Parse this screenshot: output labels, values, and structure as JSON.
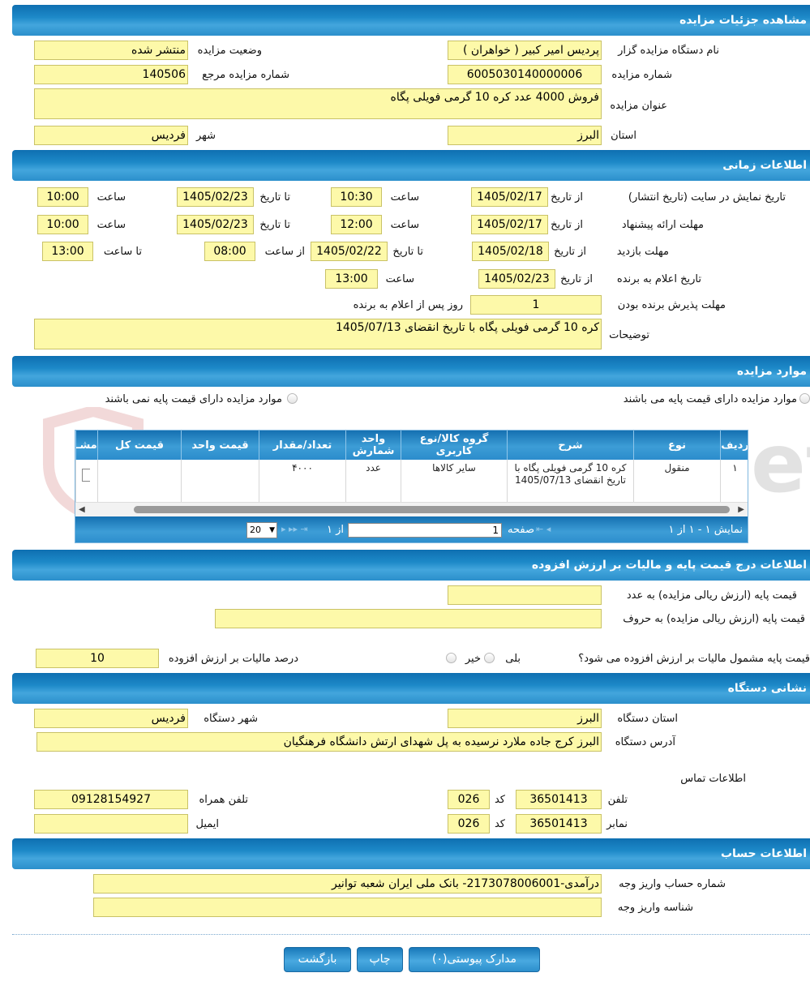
{
  "sections": {
    "details": "مشاهده جزئیات مزایده",
    "time": "اطلاعات زمانی",
    "items": "موارد مزایده",
    "price": "اطلاعات درج قیمت پایه و مالیات بر ارزش افزوده",
    "address": "نشانی دستگاه",
    "account": "اطلاعات حساب"
  },
  "details": {
    "org_label": "نام دستگاه مزایده گزار",
    "org_value": "پردیس امیر کبیر ( خواهران )",
    "status_label": "وضعیت مزایده",
    "status_value": "منتشر شده",
    "number_label": "شماره مزایده",
    "number_value": "6005030140000006",
    "ref_label": "شماره مزایده مرجع",
    "ref_value": "140506",
    "title_label": "عنوان مزایده",
    "title_value": "فروش 4000 عدد کره 10 گرمی فویلی پگاه",
    "province_label": "استان",
    "province_value": "البرز",
    "city_label": "شهر",
    "city_value": "فردیس"
  },
  "time": {
    "display_label": "تاریخ نمایش در سایت (تاریخ انتشار)",
    "display_from": "1405/02/17",
    "display_from_time": "10:30",
    "display_to": "1405/02/23",
    "display_to_time": "10:00",
    "offer_label": "مهلت ارائه پیشنهاد",
    "offer_from": "1405/02/17",
    "offer_from_time": "12:00",
    "offer_to": "1405/02/23",
    "offer_to_time": "10:00",
    "visit_label": "مهلت بازدید",
    "visit_from": "1405/02/18",
    "visit_to": "1405/02/22",
    "visit_from_time": "08:00",
    "visit_to_time": "13:00",
    "announce_label": "تاریخ اعلام به برنده",
    "announce_date": "1405/02/23",
    "announce_time": "13:00",
    "accept_label": "مهلت پذیرش برنده بودن",
    "accept_value": "1",
    "accept_suffix": "روز پس از اعلام به برنده",
    "desc_label": "توضیحات",
    "desc_value": "کره 10 گرمی فویلی پگاه با تاریخ انقضای 1405/07/13",
    "from_date": "از تاریخ",
    "to_date": "تا تاریخ",
    "hour": "ساعت",
    "from_hour": "از ساعت",
    "to_hour": "تا ساعت"
  },
  "items": {
    "with_base": "موارد مزایده دارای قیمت پایه می باشند",
    "without_base": "موارد مزایده دارای قیمت پایه نمی باشند",
    "columns": [
      "ردیف",
      "نوع",
      "شرح",
      "گروه کالا/نوع کاربری",
      "واحد شمارش",
      "تعداد/مقدار",
      "قیمت واحد",
      "قیمت کل",
      "مشـ"
    ],
    "rows": [
      {
        "row": "۱",
        "type": "منقول",
        "desc": "کره 10 گرمی فویلی پگاه با تاریخ انقضای 1405/07/13",
        "group": "سایر کالاها",
        "unit": "عدد",
        "qty": "۴۰۰۰",
        "unit_price": "",
        "total": ""
      }
    ],
    "pager": {
      "display": "نمایش ۱ - ۱ از ۱",
      "page_label": "صفحه",
      "page_value": "1",
      "of": "از ۱",
      "size": "20"
    }
  },
  "price": {
    "base_num_label": "قیمت پایه (ارزش ریالی مزایده) به عدد",
    "base_num_value": "",
    "base_text_label": "قیمت پایه (ارزش ریالی مزایده) به حروف",
    "base_text_value": "",
    "vat_question": "قیمت پایه مشمول مالیات بر ارزش افزوده می شود؟",
    "yes": "بلی",
    "no": "خیر",
    "vat_label": "درصد مالیات بر ارزش افزوده",
    "vat_value": "10"
  },
  "address": {
    "province_label": "استان دستگاه",
    "province_value": "البرز",
    "city_label": "شهر دستگاه",
    "city_value": "فردیس",
    "addr_label": "آدرس دستگاه",
    "addr_value": "البرز کرج جاده ملارد نرسیده به پل شهدای ارتش دانشگاه فرهنگیان",
    "contact_label": "اطلاعات تماس",
    "phone_label": "تلفن",
    "phone_value": "36501413",
    "code_label": "کد",
    "phone_code": "026",
    "mobile_label": "تلفن همراه",
    "mobile_value": "09128154927",
    "fax_label": "نمابر",
    "fax_value": "36501413",
    "fax_code": "026",
    "email_label": "ایمیل",
    "email_value": ""
  },
  "account": {
    "acc_label": "شماره حساب واریز وجه",
    "acc_value": "درآمدی-2173078006001- بانک ملی ایران شعبه توانیر",
    "id_label": "شناسه واریز وجه",
    "id_value": ""
  },
  "buttons": {
    "attachments": "مدارک پیوستی(۰)",
    "print": "چاپ",
    "back": "بازگشت"
  },
  "colors": {
    "field": "#fdf9a9",
    "header": "#1d89c8"
  }
}
